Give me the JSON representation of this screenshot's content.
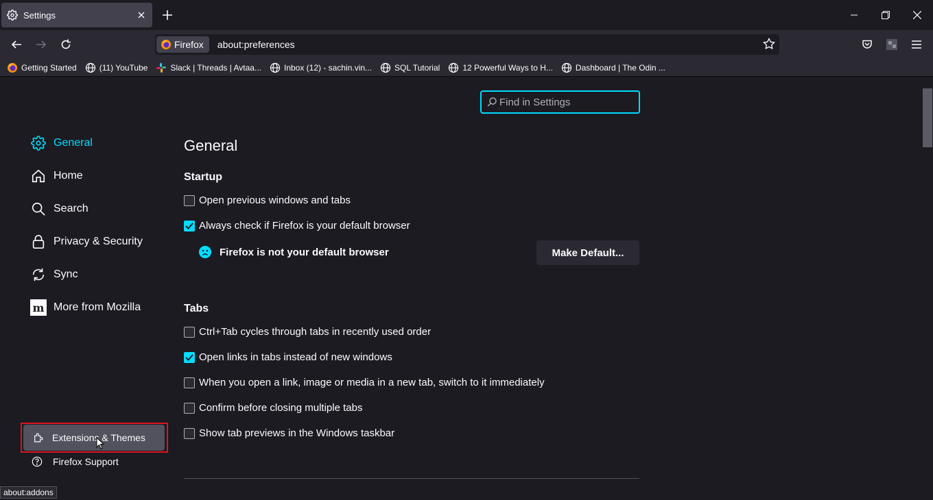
{
  "tab": {
    "title": "Settings"
  },
  "urlbar": {
    "identity_label": "Firefox",
    "url": "about:preferences"
  },
  "bookmarks": [
    {
      "label": "Getting Started",
      "icon": "firefox-icon"
    },
    {
      "label": "(11) YouTube",
      "icon": "globe-icon"
    },
    {
      "label": "Slack | Threads | Avtaa...",
      "icon": "slack-icon"
    },
    {
      "label": "Inbox (12) - sachin.vin...",
      "icon": "globe-icon"
    },
    {
      "label": "SQL Tutorial",
      "icon": "globe-icon"
    },
    {
      "label": "12 Powerful Ways to H...",
      "icon": "globe-icon"
    },
    {
      "label": "Dashboard | The Odin ...",
      "icon": "globe-icon"
    }
  ],
  "search": {
    "placeholder": "Find in Settings"
  },
  "sidebar": {
    "categories": [
      {
        "label": "General",
        "icon": "gear-icon",
        "active": true
      },
      {
        "label": "Home",
        "icon": "home-icon"
      },
      {
        "label": "Search",
        "icon": "search-icon"
      },
      {
        "label": "Privacy & Security",
        "icon": "lock-icon"
      },
      {
        "label": "Sync",
        "icon": "sync-icon"
      },
      {
        "label": "More from Mozilla",
        "icon": "mozilla-icon"
      }
    ],
    "extensions_label": "Extensions & Themes",
    "support_label": "Firefox Support"
  },
  "main": {
    "title": "General",
    "startup": {
      "heading": "Startup",
      "open_previous": {
        "label": "Open previous windows and tabs",
        "checked": false
      },
      "always_check": {
        "label": "Always check if Firefox is your default browser",
        "checked": true
      },
      "not_default": "Firefox is not your default browser",
      "make_default": "Make Default..."
    },
    "tabs": {
      "heading": "Tabs",
      "items": [
        {
          "label": "Ctrl+Tab cycles through tabs in recently used order",
          "checked": false
        },
        {
          "label": "Open links in tabs instead of new windows",
          "checked": true
        },
        {
          "label": "When you open a link, image or media in a new tab, switch to it immediately",
          "checked": false
        },
        {
          "label": "Confirm before closing multiple tabs",
          "checked": false
        },
        {
          "label": "Show tab previews in the Windows taskbar",
          "checked": false
        }
      ]
    }
  },
  "status": {
    "url": "about:addons"
  },
  "colors": {
    "accent": "#00ddff",
    "highlight": "#e0141e",
    "background": "#1c1b22"
  }
}
